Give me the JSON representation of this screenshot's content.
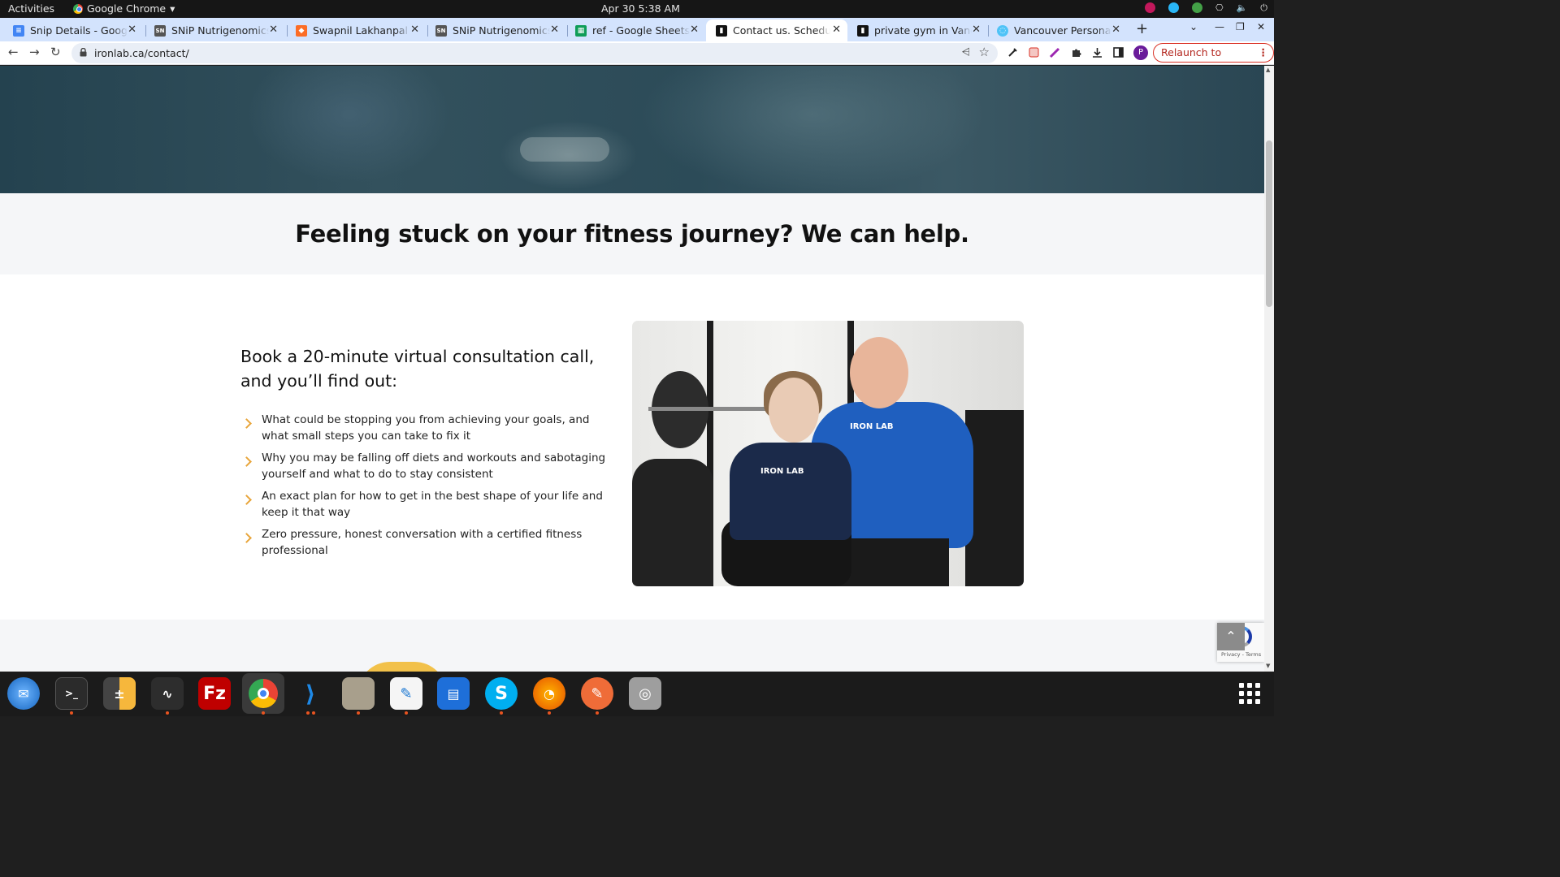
{
  "system": {
    "activities": "Activities",
    "app_name": "Google Chrome",
    "clock": "Apr 30  5:38 AM"
  },
  "browser": {
    "tabs": [
      {
        "title": "Snip Details - Google Docs",
        "icon": "google-docs-icon",
        "active": false
      },
      {
        "title": "SNiP Nutrigenomics Admin",
        "icon": "snip-icon",
        "active": false
      },
      {
        "title": "Swapnil Lakhanpal / SNiP",
        "icon": "gitlab-icon",
        "active": false
      },
      {
        "title": "SNiP Nutrigenomics Admin",
        "icon": "snip-icon",
        "active": false
      },
      {
        "title": "ref - Google Sheets",
        "icon": "google-sheets-icon",
        "active": false
      },
      {
        "title": "Contact us. Schedule",
        "icon": "ironlab-icon",
        "active": true
      },
      {
        "title": "private gym in Vancouver",
        "icon": "ironlab-icon",
        "active": false
      },
      {
        "title": "Vancouver Personal Trainer",
        "icon": "generic-site-icon",
        "active": false
      }
    ],
    "url": "ironlab.ca/contact/",
    "relaunch_label": "Relaunch to update",
    "profile_initial": "P"
  },
  "page": {
    "headline": "Feeling stuck on your fitness journey? We can help.",
    "consultation_heading": "Book a 20-minute virtual consultation call, and you’ll find out:",
    "bullets": [
      "What could be stopping you from achieving your goals, and what small steps you can take to fix it",
      "Why you may be falling off diets and workouts and sabotaging yourself and what to do to stay consistent",
      "An exact plan for how to get in the best shape of your life and keep it that way",
      "Zero pressure, honest conversation with a certified fitness professional"
    ],
    "photo_shirt_text": "IRON LAB",
    "recaptcha_text": "Privacy - Terms",
    "back_to_top": "⌃"
  },
  "colors": {
    "accent_chevron": "#e8a53a",
    "tab_strip": "#d3e3fd",
    "relaunch": "#b3261e"
  },
  "dock": [
    {
      "name": "thunderbird-icon"
    },
    {
      "name": "terminal-icon"
    },
    {
      "name": "calculator-icon"
    },
    {
      "name": "system-monitor-icon"
    },
    {
      "name": "filezilla-icon"
    },
    {
      "name": "chrome-icon"
    },
    {
      "name": "vscode-icon"
    },
    {
      "name": "files-icon"
    },
    {
      "name": "text-editor-icon"
    },
    {
      "name": "libreoffice-writer-icon"
    },
    {
      "name": "skype-icon"
    },
    {
      "name": "blender-icon"
    },
    {
      "name": "postman-icon"
    },
    {
      "name": "disks-icon"
    },
    {
      "name": "show-apps-icon"
    }
  ]
}
